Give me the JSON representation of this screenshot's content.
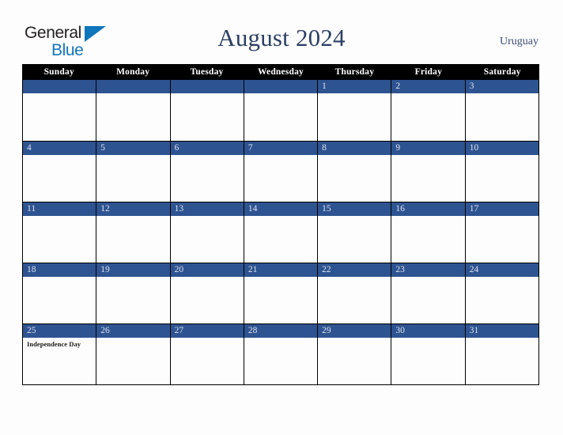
{
  "brand": {
    "name_part1": "General",
    "name_part2": "Blue",
    "triangle_icon": "triangle-icon",
    "color_dark": "#231f20",
    "color_blue": "#1076bc"
  },
  "header": {
    "title": "August 2024",
    "country": "Uruguay",
    "title_color": "#2b3f63"
  },
  "calendar": {
    "weekdays": [
      "Sunday",
      "Monday",
      "Tuesday",
      "Wednesday",
      "Thursday",
      "Friday",
      "Saturday"
    ],
    "header_bg": "#000000",
    "day_bar_bg": "#2e5391",
    "day_number_color": "#dde3ee",
    "weeks": [
      [
        {
          "day": "",
          "events": []
        },
        {
          "day": "",
          "events": []
        },
        {
          "day": "",
          "events": []
        },
        {
          "day": "",
          "events": []
        },
        {
          "day": "1",
          "events": []
        },
        {
          "day": "2",
          "events": []
        },
        {
          "day": "3",
          "events": []
        }
      ],
      [
        {
          "day": "4",
          "events": []
        },
        {
          "day": "5",
          "events": []
        },
        {
          "day": "6",
          "events": []
        },
        {
          "day": "7",
          "events": []
        },
        {
          "day": "8",
          "events": []
        },
        {
          "day": "9",
          "events": []
        },
        {
          "day": "10",
          "events": []
        }
      ],
      [
        {
          "day": "11",
          "events": []
        },
        {
          "day": "12",
          "events": []
        },
        {
          "day": "13",
          "events": []
        },
        {
          "day": "14",
          "events": []
        },
        {
          "day": "15",
          "events": []
        },
        {
          "day": "16",
          "events": []
        },
        {
          "day": "17",
          "events": []
        }
      ],
      [
        {
          "day": "18",
          "events": []
        },
        {
          "day": "19",
          "events": []
        },
        {
          "day": "20",
          "events": []
        },
        {
          "day": "21",
          "events": []
        },
        {
          "day": "22",
          "events": []
        },
        {
          "day": "23",
          "events": []
        },
        {
          "day": "24",
          "events": []
        }
      ],
      [
        {
          "day": "25",
          "events": [
            "Independence Day"
          ]
        },
        {
          "day": "26",
          "events": []
        },
        {
          "day": "27",
          "events": []
        },
        {
          "day": "28",
          "events": []
        },
        {
          "day": "29",
          "events": []
        },
        {
          "day": "30",
          "events": []
        },
        {
          "day": "31",
          "events": []
        }
      ]
    ]
  }
}
